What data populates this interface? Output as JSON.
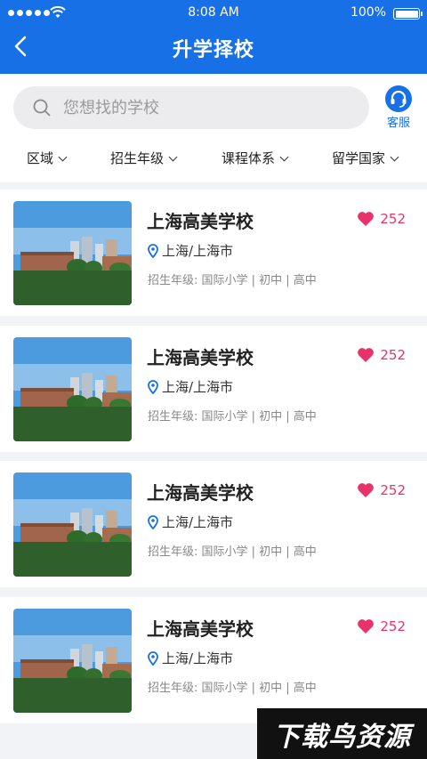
{
  "status_bar": {
    "time": "8:08 AM",
    "battery": "100%"
  },
  "header": {
    "title": "升学择校"
  },
  "search": {
    "placeholder": "您想找的学校"
  },
  "service": {
    "label": "客服"
  },
  "filters": [
    {
      "label": "区域"
    },
    {
      "label": "招生年级"
    },
    {
      "label": "课程体系"
    },
    {
      "label": "留学国家"
    }
  ],
  "schools": [
    {
      "name": "上海高美学校",
      "location": "上海/上海市",
      "grades": "招生年级: 国际小学 | 初中 | 高中",
      "likes": "252"
    },
    {
      "name": "上海高美学校",
      "location": "上海/上海市",
      "grades": "招生年级: 国际小学 | 初中 | 高中",
      "likes": "252"
    },
    {
      "name": "上海高美学校",
      "location": "上海/上海市",
      "grades": "招生年级: 国际小学 | 初中 | 高中",
      "likes": "252"
    },
    {
      "name": "上海高美学校",
      "location": "上海/上海市",
      "grades": "招生年级: 国际小学 | 初中 | 高中",
      "likes": "252"
    }
  ],
  "watermark": "下载鸟资源",
  "colors": {
    "primary": "#1870e6",
    "like": "#e8336a"
  }
}
